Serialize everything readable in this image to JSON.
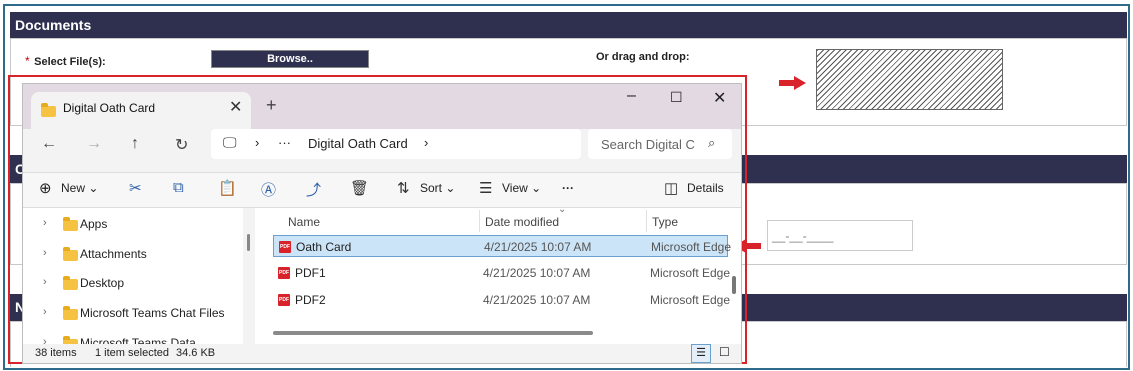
{
  "page": {
    "documents_title": "Documents",
    "required_mark": "*",
    "select_files_label": "Select File(s):",
    "browse_label": "Browse..",
    "drag_drop_label": "Or drag and drop:",
    "section2_letter": "C",
    "section3_letter": "N",
    "date_placeholder": "__-__-____",
    "colors": {
      "section_bar": "#2f3050",
      "annotation": "#d9232a"
    }
  },
  "explorer": {
    "tab_title": "Digital Oath Card",
    "breadcrumb_more": "···",
    "breadcrumb_folder": "Digital Oath Card",
    "search_placeholder": "Search Digital C",
    "toolbar": {
      "new": "New",
      "sort": "Sort",
      "view": "View",
      "more": "···",
      "details": "Details"
    },
    "nav_items": [
      {
        "label": "Apps"
      },
      {
        "label": "Attachments"
      },
      {
        "label": "Desktop"
      },
      {
        "label": "Microsoft Teams Chat Files"
      },
      {
        "label": "Microsoft Teams Data"
      }
    ],
    "columns": {
      "name": "Name",
      "date": "Date modified",
      "type": "Type"
    },
    "files": [
      {
        "name": "Oath Card",
        "date": "4/21/2025 10:07 AM",
        "type": "Microsoft Edge",
        "selected": true
      },
      {
        "name": "PDF1",
        "date": "4/21/2025 10:07 AM",
        "type": "Microsoft Edge",
        "selected": false
      },
      {
        "name": "PDF2",
        "date": "4/21/2025 10:07 AM",
        "type": "Microsoft Edge",
        "selected": false
      }
    ],
    "status": {
      "items": "38 items",
      "selected": "1 item selected",
      "size": "34.6 KB"
    }
  }
}
